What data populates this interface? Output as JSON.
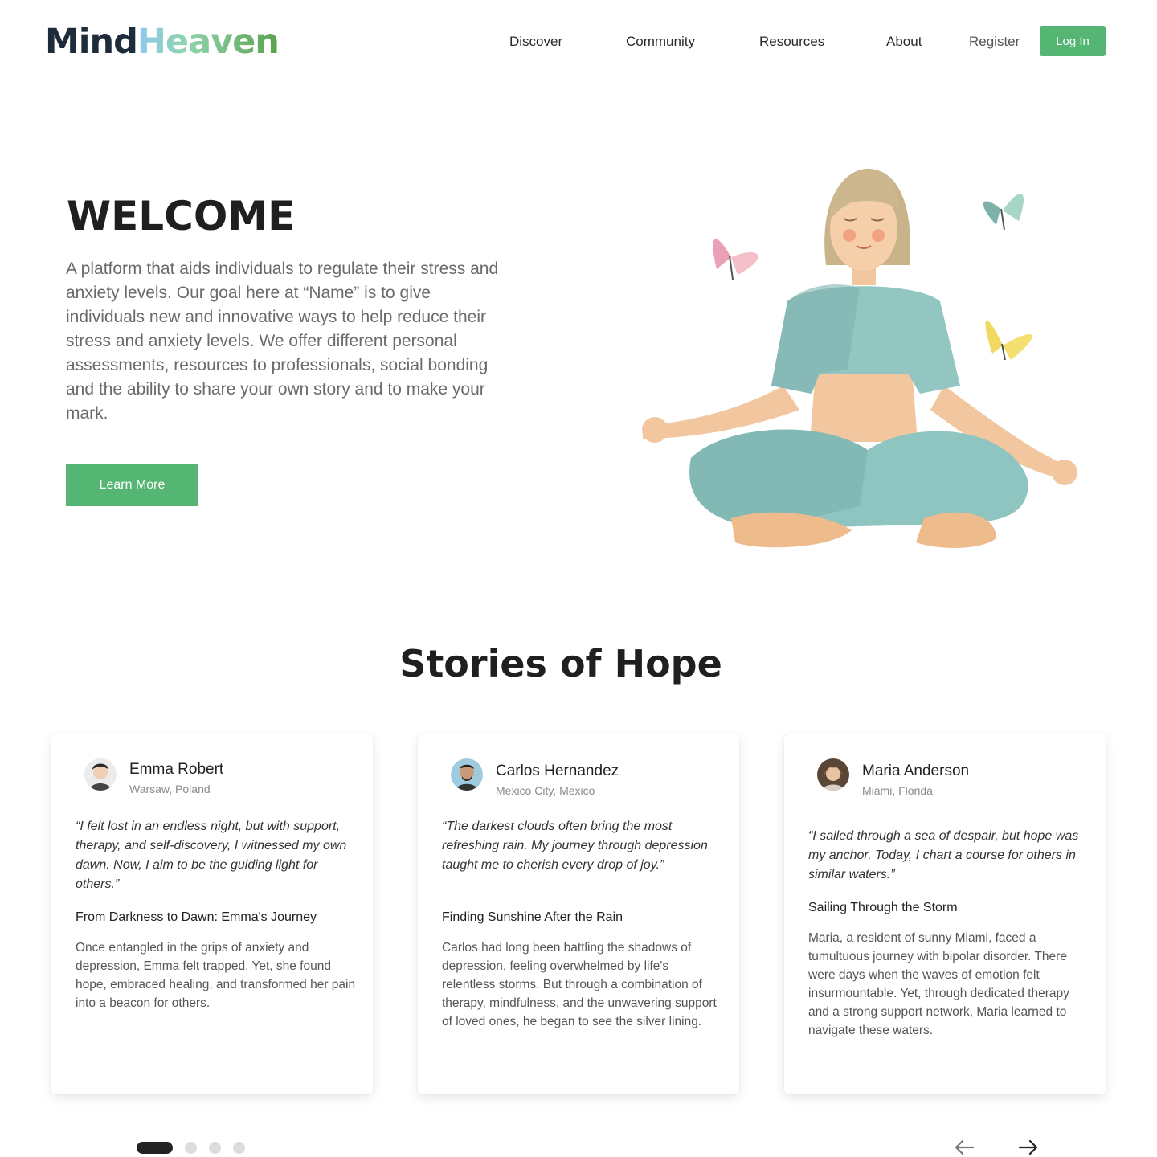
{
  "header": {
    "logo": {
      "part1": "Mind",
      "part2": "Heaven"
    },
    "nav": [
      {
        "label": "Discover"
      },
      {
        "label": "Community"
      },
      {
        "label": "Resources"
      },
      {
        "label": "About"
      }
    ],
    "register_label": "Register",
    "login_label": "Log In"
  },
  "hero": {
    "title": "WELCOME",
    "description": "A platform that aids individuals to regulate their stress and anxiety levels.  Our goal here at “Name” is to give individuals new and innovative ways to help reduce their stress and anxiety levels. We offer different personal assessments, resources to professionals, social bonding and the ability to share your own story and to make your mark.",
    "cta_label": "Learn More"
  },
  "stories": {
    "title": "Stories of Hope",
    "cards": [
      {
        "name": "Emma Robert",
        "location": "Warsaw, Poland",
        "quote": "“I felt lost in an endless night, but with support, therapy, and self-discovery, I witnessed my own dawn. Now, I aim to be the guiding light for others.”",
        "story_title": "From Darkness to Dawn: Emma's Journey",
        "body": "Once entangled in the grips of anxiety and depression, Emma felt trapped. Yet, she found hope, embraced healing, and transformed her pain into a beacon for others."
      },
      {
        "name": "Carlos Hernandez",
        "location": "Mexico City, Mexico",
        "quote": "“The darkest clouds often bring the most refreshing rain. My journey through depression taught me to cherish every drop of joy.”",
        "story_title": "Finding Sunshine After the Rain",
        "body": "Carlos had long been battling the shadows of depression, feeling overwhelmed by life's relentless storms. But through a combination of therapy, mindfulness, and the unwavering support of loved ones, he began to see the silver lining."
      },
      {
        "name": "Maria Anderson",
        "location": "Miami, Florida",
        "quote": "“I sailed through a sea of despair, but hope was my anchor. Today, I chart a course for others in similar waters.”",
        "story_title": "Sailing Through the Storm",
        "body": "Maria, a resident of sunny Miami, faced a tumultuous journey with bipolar disorder. There were days when the waves of emotion felt insurmountable. Yet, through dedicated therapy and a strong support network, Maria learned to navigate these waters."
      }
    ],
    "carousel": {
      "page_count": 4,
      "active_index": 0
    }
  },
  "icons": {
    "prev": "arrow-left-icon",
    "next": "arrow-right-icon"
  },
  "colors": {
    "accent_green": "#55b572",
    "text_dark": "#1f1f1f",
    "dot_active": "#222222",
    "dot_inactive": "#dcdcdc"
  }
}
